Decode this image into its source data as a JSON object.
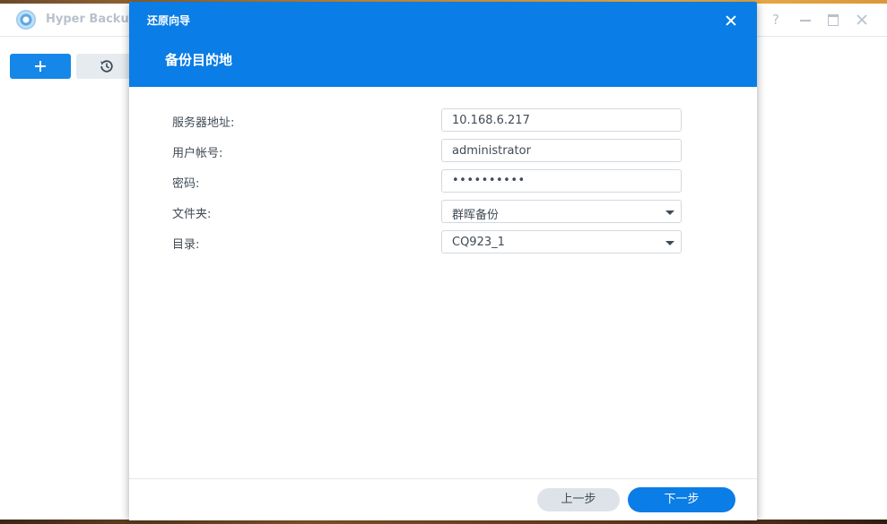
{
  "app": {
    "title": "Hyper Backup",
    "help_label": "?"
  },
  "dialog": {
    "title": "还原向导",
    "heading": "备份目的地",
    "fields": [
      {
        "label": "服务器地址:",
        "value": "10.168.6.217",
        "type": "text"
      },
      {
        "label": "用户帐号:",
        "value": "administrator",
        "type": "text"
      },
      {
        "label": "密码:",
        "value": "••••••••••",
        "type": "password"
      },
      {
        "label": "文件夹:",
        "value": "群晖备份",
        "type": "select"
      },
      {
        "label": "目录:",
        "value": "CQ923_1",
        "type": "select"
      }
    ],
    "prev_label": "上一步",
    "next_label": "下一步"
  },
  "colors": {
    "accent": "#0a7de6",
    "app_accent": "#1587e8"
  }
}
